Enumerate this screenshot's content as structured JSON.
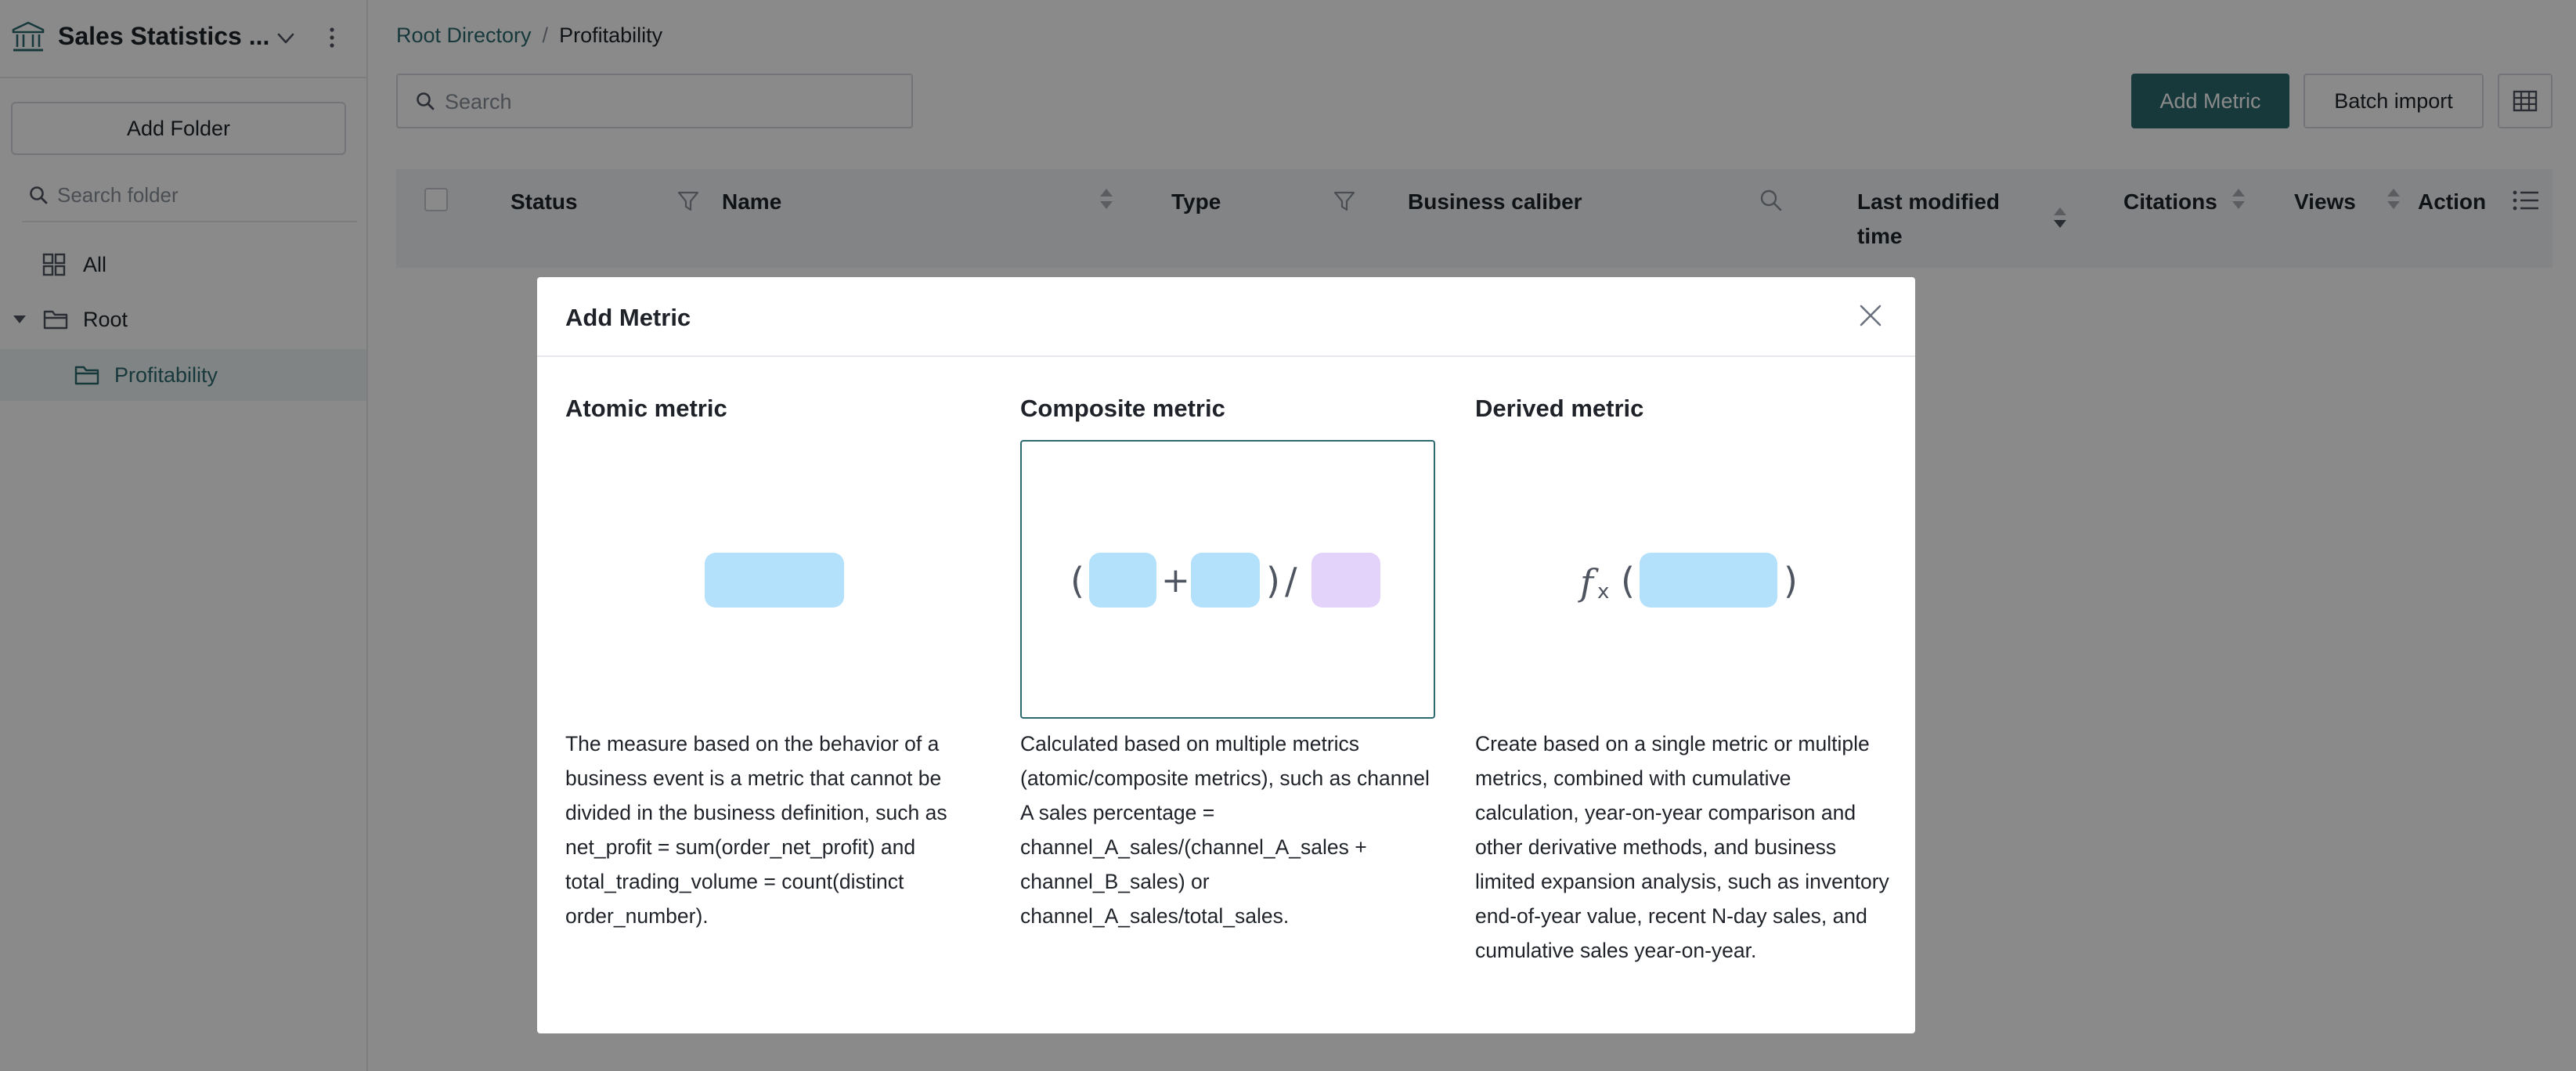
{
  "sidebar": {
    "app_title": "Sales Statistics ...",
    "add_folder_label": "Add Folder",
    "search_placeholder": "Search folder",
    "tree": {
      "all": "All",
      "root": "Root",
      "profitability": "Profitability"
    }
  },
  "breadcrumb": {
    "root": "Root Directory",
    "separator": "/",
    "current": "Profitability"
  },
  "toolbar": {
    "search_placeholder": "Search",
    "add_metric_label": "Add Metric",
    "batch_import_label": "Batch import"
  },
  "table": {
    "columns": {
      "status": "Status",
      "name": "Name",
      "type": "Type",
      "business_caliber": "Business caliber",
      "last_modified_line1": "Last modified",
      "last_modified_line2": "time",
      "citations": "Citations",
      "views": "Views",
      "action": "Action"
    }
  },
  "modal": {
    "title": "Add Metric",
    "options": [
      {
        "title": "Atomic metric",
        "description": "The measure based on the behavior of a business event is a metric that cannot be divided in the business definition, such as net_profit = sum(order_net_profit) and total_trading_volume = count(distinct order_number)."
      },
      {
        "title": "Composite metric",
        "description": "Calculated based on multiple metrics (atomic/composite metrics), such as channel A sales percentage = channel_A_sales/(channel_A_sales + channel_B_sales) or channel_A_sales/total_sales."
      },
      {
        "title": "Derived metric",
        "description": "Create based on a single metric or multiple metrics, combined with cumulative calculation, year-on-year comparison and other derivative methods, and business limited expansion analysis, such as inventory end-of-year value, recent N-day sales, and cumulative sales year-on-year."
      }
    ],
    "selected": "Composite metric"
  },
  "colors": {
    "accent": "#2d6a70",
    "metric_block_blue": "#b3e0fb",
    "metric_block_purple": "#e3d3fb"
  },
  "icons": [
    "bank-icon",
    "chevron-down-icon",
    "more-vertical-icon",
    "search-icon",
    "grid-icon",
    "folder-icon",
    "caret-down-icon",
    "filter-icon",
    "sort-icon",
    "list-icon",
    "close-icon",
    "function-icon"
  ]
}
